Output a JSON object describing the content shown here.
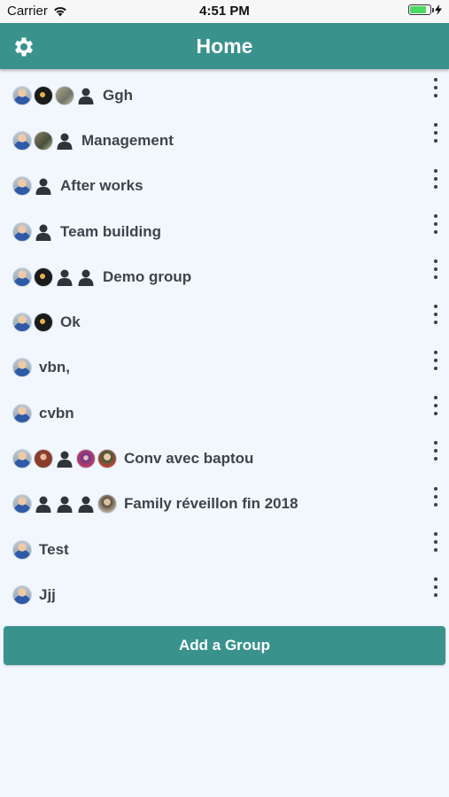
{
  "status_bar": {
    "carrier": "Carrier",
    "time": "4:51 PM",
    "battery_level": 0.9
  },
  "header": {
    "title": "Home",
    "settings_icon": "gear-icon"
  },
  "groups": [
    {
      "name": "Ggh",
      "avatars": [
        "user",
        "dark",
        "room",
        "person"
      ]
    },
    {
      "name": "Management",
      "avatars": [
        "user",
        "room2",
        "person"
      ]
    },
    {
      "name": "After works",
      "avatars": [
        "user",
        "person"
      ]
    },
    {
      "name": "Team building",
      "avatars": [
        "user",
        "person"
      ]
    },
    {
      "name": "Demo group",
      "avatars": [
        "user",
        "dark",
        "person",
        "person"
      ]
    },
    {
      "name": "Ok",
      "avatars": [
        "user",
        "dark"
      ]
    },
    {
      "name": "vbn,",
      "avatars": [
        "user"
      ]
    },
    {
      "name": "cvbn",
      "avatars": [
        "user"
      ]
    },
    {
      "name": "Conv avec baptou",
      "avatars": [
        "user",
        "girl",
        "person",
        "purple",
        "man"
      ]
    },
    {
      "name": "Family réveillon fin 2018",
      "avatars": [
        "user",
        "person",
        "person",
        "person",
        "old"
      ]
    },
    {
      "name": "Test",
      "avatars": [
        "user"
      ]
    },
    {
      "name": "Jjj",
      "avatars": [
        "user"
      ]
    }
  ],
  "add_button": {
    "label": "Add a Group"
  },
  "colors": {
    "accent": "#3a928d",
    "background": "#f2f7fd",
    "text": "#3f4449"
  }
}
